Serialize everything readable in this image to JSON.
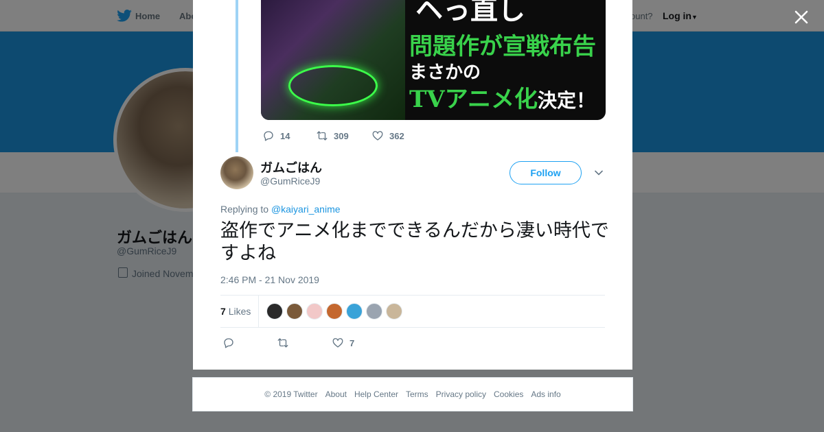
{
  "background": {
    "nav": {
      "home": "Home",
      "about": "Abo",
      "account_question": "ccount?",
      "login": "Log in"
    },
    "profile": {
      "name": "ガムごはん",
      "handle": "@GumRiceJ9",
      "joined": "Joined Novem"
    },
    "colors": {
      "banner": "#1b95e0",
      "overlay": "rgba(0,0,0,0.5)"
    }
  },
  "modal": {
    "parent_tweet": {
      "media": {
        "top_text": "ヘっ直し",
        "line1": "問題作が宣戦布告",
        "line2": "まさかの",
        "line3_main": "TVアニメ化",
        "line3_small": "決定！"
      },
      "actions": {
        "reply_count": "14",
        "retweet_count": "309",
        "like_count": "362"
      }
    },
    "tweet": {
      "author_name": "ガムごはん",
      "author_handle": "@GumRiceJ9",
      "follow_label": "Follow",
      "replying_prefix": "Replying to",
      "replying_to": "@kaiyari_anime",
      "text": "盗作でアニメ化までできるんだから凄い時代ですよね",
      "timestamp": "2:46 PM - 21 Nov 2019",
      "likes_number": "7",
      "likes_label": "Likes",
      "likers": [
        {
          "color": "#2a2a2a"
        },
        {
          "color": "#7a5a3a"
        },
        {
          "color": "#f2c8c8"
        },
        {
          "color": "#c4672e"
        },
        {
          "color": "#3aa3d8"
        },
        {
          "color": "#9aa4b0"
        },
        {
          "color": "#c9b69a"
        }
      ],
      "actions": {
        "reply_count": "",
        "retweet_count": "",
        "like_count": "7"
      }
    }
  },
  "footer": {
    "links": [
      "© 2019 Twitter",
      "About",
      "Help Center",
      "Terms",
      "Privacy policy",
      "Cookies",
      "Ads info"
    ]
  },
  "icons": {
    "twitter_bird": "twitter-bird-icon",
    "close": "close-icon",
    "reply": "reply-icon",
    "retweet": "retweet-icon",
    "like": "heart-icon",
    "caret": "chevron-down-icon"
  },
  "colors": {
    "accent": "#1da1f2",
    "link": "#1b95e0",
    "muted": "#657786",
    "text": "#14171a"
  }
}
